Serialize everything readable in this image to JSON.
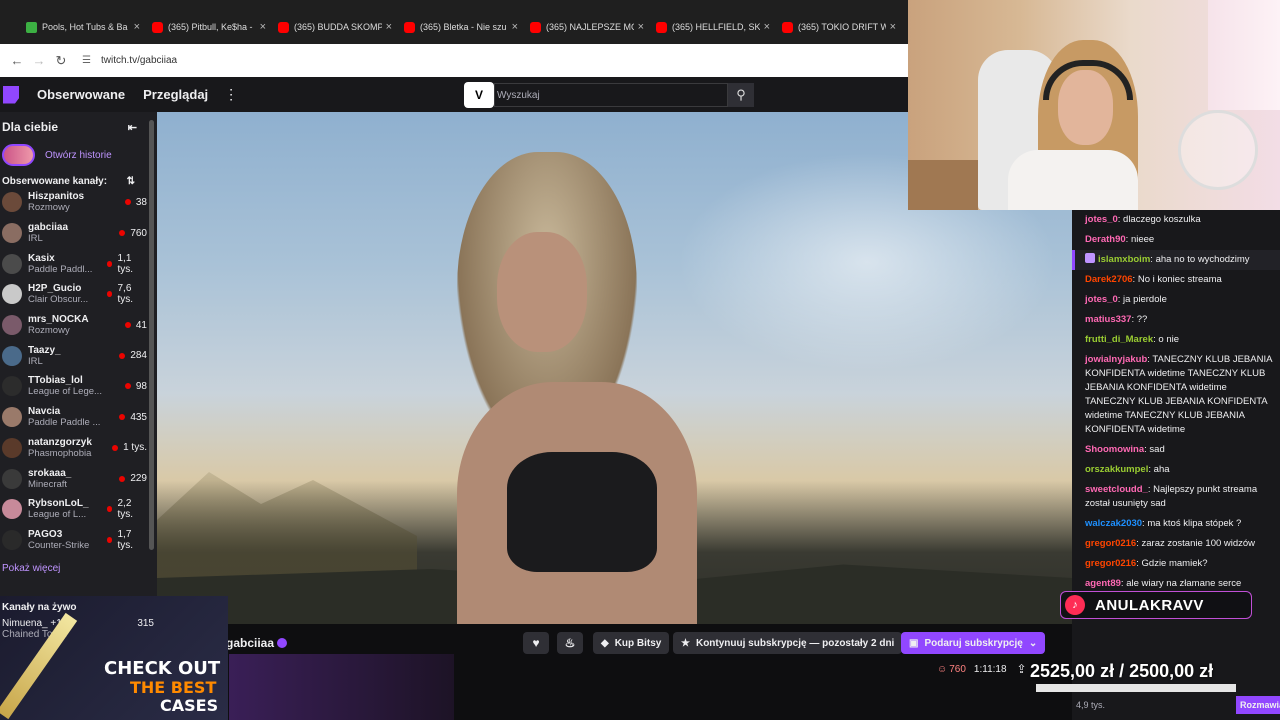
{
  "browser": {
    "tabs": [
      {
        "title": "Pools, Hot Tubs & Ba",
        "icon": "k"
      },
      {
        "title": "(365) Pitbull, Ke$ha -",
        "icon": "yt"
      },
      {
        "title": "(365) BUDDA SKOMP",
        "icon": "yt"
      },
      {
        "title": "(365) Bletka - Nie szu",
        "icon": "yt"
      },
      {
        "title": "(365) NAJLEPSZE MC",
        "icon": "yt"
      },
      {
        "title": "(365) HELLFIELD, SKO",
        "icon": "yt"
      },
      {
        "title": "(365) TOKIO DRIFT W",
        "icon": "yt"
      }
    ],
    "url": "twitch.tv/gabciiaa"
  },
  "nav": {
    "following": "Obserwowane",
    "browse": "Przeglądaj",
    "search_placeholder": "Wyszukaj"
  },
  "sidebar": {
    "for_you": "Dla ciebie",
    "open_stories": "Otwórz historie",
    "followed_channels": "Obserwowane kanały:",
    "channels": [
      {
        "name": "Hiszpanitos",
        "game": "Rozmowy",
        "viewers": "38",
        "color": "#6b4a3a"
      },
      {
        "name": "gabciiaa",
        "game": "IRL",
        "viewers": "760",
        "color": "#8a6d62"
      },
      {
        "name": "Kasix",
        "game": "Paddle Paddl...",
        "viewers": "1,1 tys.",
        "color": "#4b4b4b"
      },
      {
        "name": "H2P_Gucio",
        "game": "Clair Obscur...",
        "viewers": "7,6 tys.",
        "color": "#c9c9c9"
      },
      {
        "name": "mrs_NOCKA",
        "game": "Rozmowy",
        "viewers": "41",
        "color": "#7a5a6a"
      },
      {
        "name": "Taazy_",
        "game": "IRL",
        "viewers": "284",
        "color": "#4a6a8a"
      },
      {
        "name": "TTobias_lol",
        "game": "League of Lege...",
        "viewers": "98",
        "color": "#2c2c2c"
      },
      {
        "name": "Navcia",
        "game": "Paddle Paddle ...",
        "viewers": "435",
        "color": "#9a7a6a"
      },
      {
        "name": "natanzgorzyk",
        "game": "Phasmophobia",
        "viewers": "1 tys.",
        "color": "#5a3a2a"
      },
      {
        "name": "srokaaa_",
        "game": "Minecraft",
        "viewers": "229",
        "color": "#3a3a3a"
      },
      {
        "name": "RybsonLoL_",
        "game": "League of L...",
        "viewers": "2,2 tys.",
        "color": "#c78a9a"
      },
      {
        "name": "PAGO3",
        "game": "Counter-Strike",
        "viewers": "1,7 tys.",
        "color": "#2a2a2a"
      }
    ],
    "show_more": "Pokaż więcej",
    "live_channels": "Kanały na żywo",
    "live_first": {
      "name": "Nimuena_ +1",
      "game": "Chained Toget",
      "viewers": "315"
    }
  },
  "stream": {
    "username": "gabciiaa",
    "buy_bits": "Kup Bitsy",
    "continue_sub": "Kontynuuj subskrypcję — pozostały 2 dni",
    "gift_sub": "Podaruj subskrypcję",
    "viewers": "760",
    "uptime": "1:11:18"
  },
  "chat": {
    "messages": [
      {
        "user": "jotes_0",
        "color": "#ff69b4",
        "text": "dlaczego koszulka"
      },
      {
        "user": "Derath90",
        "color": "#ff69b4",
        "text": "nieee"
      },
      {
        "user": "islamxboim",
        "color": "#9acd32",
        "text": "aha no to wychodzimy",
        "highlight": true
      },
      {
        "user": "Darek2706",
        "color": "#ff4500",
        "text": "No i koniec streama"
      },
      {
        "user": "jotes_0",
        "color": "#ff69b4",
        "text": "ja pierdole"
      },
      {
        "user": "matius337",
        "color": "#ff69b4",
        "text": "??"
      },
      {
        "user": "frutti_di_Marek",
        "color": "#9acd32",
        "text": "o nie"
      },
      {
        "user": "jowialnyjakub",
        "color": "#ff69b4",
        "text": "TANECZNY KLUB JEBANIA KONFIDENTA widetime TANECZNY KLUB JEBANIA KONFIDENTA widetime TANECZNY KLUB JEBANIA KONFIDENTA widetime TANECZNY KLUB JEBANIA KONFIDENTA widetime"
      },
      {
        "user": "Shoomowina",
        "color": "#ff69b4",
        "text": "sad"
      },
      {
        "user": "orszakkumpel",
        "color": "#9acd32",
        "text": "aha"
      },
      {
        "user": "sweetcloudd_",
        "color": "#ff69b4",
        "text": "Najlepszy punkt streama został usunięty sad"
      },
      {
        "user": "walczak2030",
        "color": "#1e90ff",
        "text": "ma ktoś klipa stópek ?"
      },
      {
        "user": "gregor0216",
        "color": "#ff4500",
        "text": "zaraz zostanie 100 widzów"
      },
      {
        "user": "gregor0216",
        "color": "#ff4500",
        "text": "Gdzie mamiek?"
      },
      {
        "user": "agent89",
        "color": "#ff69b4",
        "text": "ale wiary na złamane serce"
      }
    ],
    "footer_viewers": "4,9 tys.",
    "talk_button": "Rozmawia"
  },
  "overlay": {
    "tiktok_name": "ANULAKRAVV",
    "goal_text": "2525,00 zł / 2500,00 zł",
    "goal_progress": 1.0
  },
  "promo": {
    "line1": "CHECK OUT",
    "line2": "THE BEST",
    "line3": "CASES"
  }
}
